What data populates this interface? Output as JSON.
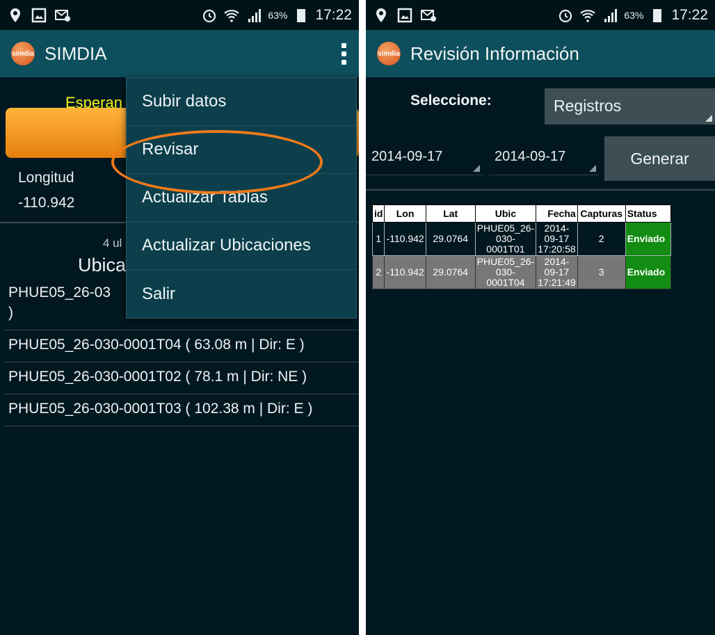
{
  "left": {
    "status": {
      "battery": "63%",
      "time": "17:22"
    },
    "app_title": "SIMDIA",
    "logo_text": "simdia",
    "waiting_text": "Esperan",
    "longitude_label": "Longitud",
    "longitude_value": "-110.942",
    "last_label": "4 ul",
    "ubic_title": "Ubica",
    "list": [
      "PHUE05_26-03",
      ")",
      "PHUE05_26-030-0001T04 ( 63.08 m | Dir: E )",
      "PHUE05_26-030-0001T02 ( 78.1 m | Dir: NE )",
      "PHUE05_26-030-0001T03 ( 102.38 m | Dir: E )"
    ],
    "menu": [
      "Subir datos",
      "Revisar",
      "Actualizar Tablas",
      "Actualizar Ubicaciones",
      "Salir"
    ]
  },
  "right": {
    "status": {
      "battery": "63%",
      "time": "17:22"
    },
    "app_title": "Revisión Información",
    "logo_text": "simdia",
    "select_label": "Seleccione:",
    "select_value": "Registros",
    "date_from": "2014-09-17",
    "date_to": "2014-09-17",
    "generate_label": "Generar",
    "table": {
      "headers": [
        "id",
        "Lon",
        "Lat",
        "Ubic",
        "Fecha",
        "Capturas",
        "Status"
      ],
      "rows": [
        {
          "id": "1",
          "lon": "-110.942",
          "lat": "29.0764",
          "ubic": [
            "PHUE05_26-",
            "030-",
            "0001T01"
          ],
          "fecha": [
            "2014-",
            "09-17",
            "17:20:58"
          ],
          "capturas": "2",
          "status": "Enviado"
        },
        {
          "id": "2",
          "lon": "-110.942",
          "lat": "29.0764",
          "ubic": [
            "PHUE05_26-",
            "030-",
            "0001T04"
          ],
          "fecha": [
            "2014-",
            "09-17",
            "17:21:49"
          ],
          "capturas": "3",
          "status": "Enviado"
        }
      ]
    }
  },
  "colors": {
    "appbar": "#0d4f5c",
    "background": "#021821",
    "accent_orange": "#f07a19",
    "status_green": "#128c12"
  },
  "icons": [
    "location-icon",
    "gallery-icon",
    "sms-icon",
    "alarm-icon",
    "wifi-icon",
    "signal-icon",
    "battery-icon",
    "overflow-menu-icon"
  ]
}
